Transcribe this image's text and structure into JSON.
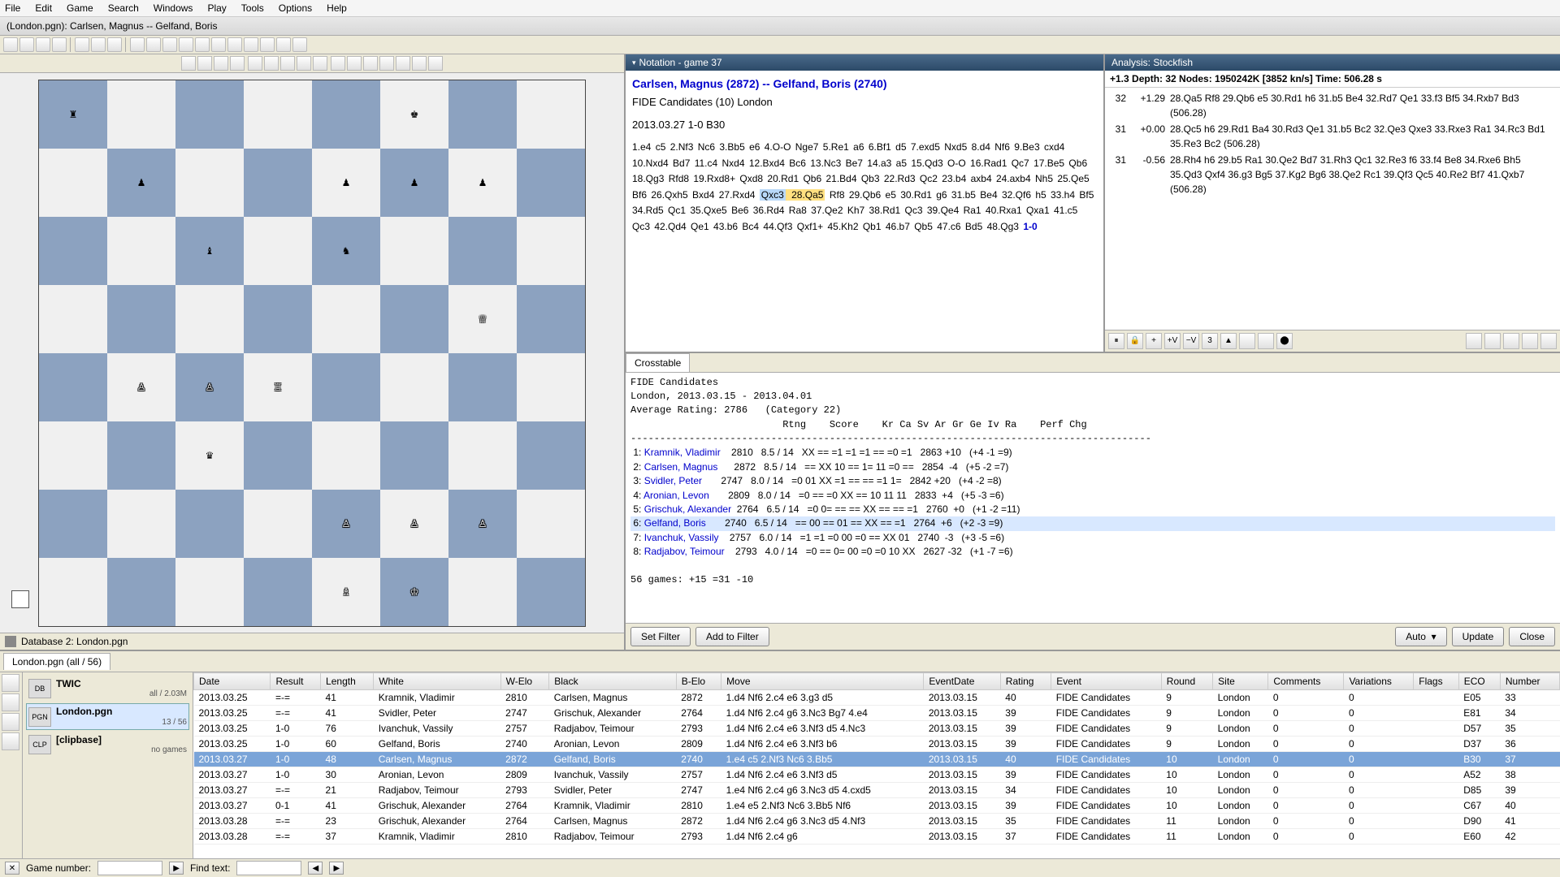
{
  "menus": [
    "File",
    "Edit",
    "Game",
    "Search",
    "Windows",
    "Play",
    "Tools",
    "Options",
    "Help"
  ],
  "window_title": "(London.pgn): Carlsen, Magnus -- Gelfand, Boris",
  "db_bar": "Database 2: London.pgn",
  "notation": {
    "panel_title": "Notation - game 37",
    "header": "Carlsen, Magnus  (2872)   --   Gelfand, Boris  (2740)",
    "sub1": "FIDE Candidates (10)  London",
    "sub2": "2013.03.27  1-0  B30",
    "moves_pre": "1.e4 c5 2.Nf3 Nc6 3.Bb5 e6 4.O-O Nge7 5.Re1 a6 6.Bf1 d5 7.exd5 Nxd5 8.d4 Nf6 9.Be3 cxd4 10.Nxd4 Bd7 11.c4 Nxd4 12.Bxd4 Bc6 13.Nc3 Be7 14.a3 a5 15.Qd3 O-O 16.Rad1 Qc7 17.Be5 Qb6 18.Qg3 Rfd8 19.Rxd8+ Qxd8 20.Rd1 Qb6 21.Bd4 Qb3 22.Rd3 Qc2 23.b4 axb4 24.axb4 Nh5 25.Qe5 Bf6 26.Qxh5 Bxd4 27.Rxd4 ",
    "hl_move": "Qxc3",
    "hl_next": " 28.Qa5",
    "moves_post": " Rf8 29.Qb6 e5 30.Rd1 g6 31.b5 Be4 32.Qf6 h5 33.h4 Bf5 34.Rd5 Qc1 35.Qxe5 Be6 36.Rd4 Ra8 37.Qe2 Kh7 38.Rd1 Qc3 39.Qe4 Ra1 40.Rxa1 Qxa1 41.c5 Qc3 42.Qd4 Qe1 43.b6 Bc4 44.Qf3 Qxf1+ 45.Kh2 Qb1 46.b7 Qb5 47.c6 Bd5 48.Qg3 ",
    "result": "1-0"
  },
  "analysis": {
    "panel_title": "Analysis: Stockfish",
    "head": "+1.3 Depth: 32 Nodes: 1950242K [3852 kn/s] Time: 506.28 s",
    "lines": [
      {
        "d": "32",
        "s": "+1.29",
        "pv": "28.Qa5 Rf8 29.Qb6 e5 30.Rd1 h6 31.b5 Be4 32.Rd7 Qe1 33.f3 Bf5 34.Rxb7 Bd3   (506.28)"
      },
      {
        "d": "31",
        "s": "+0.00",
        "pv": "28.Qc5 h6 29.Rd1 Ba4 30.Rd3 Qe1 31.b5 Bc2 32.Qe3 Qxe3 33.Rxe3 Ra1 34.Rc3 Bd1 35.Re3 Bc2   (506.28)"
      },
      {
        "d": "31",
        "s": "-0.56",
        "pv": "28.Rh4 h6 29.b5 Ra1 30.Qe2 Bd7 31.Rh3 Qc1 32.Re3 f6 33.f4 Be8 34.Rxe6 Bh5 35.Qd3 Qxf4 36.g3 Bg5 37.Kg2 Bg6 38.Qe2 Rc1 39.Qf3 Qc5 40.Re2 Bf7 41.Qxb7   (506.28)"
      }
    ],
    "tb_num": "3"
  },
  "crosstable": {
    "tab": "Crosstable",
    "text0": "FIDE Candidates",
    "text1": "London, 2013.03.15 - 2013.04.01",
    "text2": "Average Rating: 2786   (Category 22)",
    "hdr": "                          Rtng    Score    Kr Ca Sv Ar Gr Ge Iv Ra    Perf Chg",
    "sep": "-----------------------------------------------------------------------------------------",
    "rows": [
      " 1: Kramnik, Vladimir    2810   8.5 / 14   XX == =1 =1 =1 == =0 =1   2863 +10   (+4 -1 =9)",
      " 2: Carlsen, Magnus      2872   8.5 / 14   == XX 10 == 1= 11 =0 ==   2854  -4   (+5 -2 =7)",
      " 3: Svidler, Peter       2747   8.0 / 14   =0 01 XX =1 == == =1 1=   2842 +20   (+4 -2 =8)",
      " 4: Aronian, Levon       2809   8.0 / 14   =0 == =0 XX == 10 11 11   2833  +4   (+5 -3 =6)",
      " 5: Grischuk, Alexander  2764   6.5 / 14   =0 0= == == XX == == =1   2760  +0   (+1 -2 =11)",
      " 6: Gelfand, Boris       2740   6.5 / 14   == 00 == 01 == XX == =1   2764  +6   (+2 -3 =9)",
      " 7: Ivanchuk, Vassily    2757   6.0 / 14   =1 =1 =0 00 =0 == XX 01   2740  -3   (+3 -5 =6)",
      " 8: Radjabov, Teimour    2793   4.0 / 14   =0 == 0= 00 =0 =0 10 XX   2627 -32   (+1 -7 =6)"
    ],
    "hl_row_index": 5,
    "foot": "56 games: +15 =31 -10",
    "btns": {
      "set": "Set Filter",
      "add": "Add to Filter",
      "auto": "Auto",
      "update": "Update",
      "close": "Close"
    }
  },
  "bottom_tab": "London.pgn (all / 56)",
  "db_items": [
    {
      "name": "TWIC",
      "sub": "all / 2.03M",
      "sel": false,
      "ico": "DB"
    },
    {
      "name": "London.pgn",
      "sub": "13 / 56",
      "sel": true,
      "ico": "PGN"
    },
    {
      "name": "[clipbase]",
      "sub": "no games",
      "sel": false,
      "ico": "CLP"
    }
  ],
  "gl_headers": [
    "Date",
    "Result",
    "Length",
    "White",
    "W-Elo",
    "Black",
    "B-Elo",
    "Move",
    "EventDate",
    "Rating",
    "Event",
    "Round",
    "Site",
    "Comments",
    "Variations",
    "Flags",
    "ECO",
    "Number"
  ],
  "gl_rows": [
    {
      "sel": false,
      "c": [
        "2013.03.25",
        "=-=",
        "41",
        "Kramnik, Vladimir",
        "2810",
        "Carlsen, Magnus",
        "2872",
        "1.d4 Nf6 2.c4 e6 3.g3 d5",
        "2013.03.15",
        "40",
        "FIDE Candidates",
        "9",
        "London",
        "0",
        "0",
        "",
        "E05",
        "33"
      ]
    },
    {
      "sel": false,
      "c": [
        "2013.03.25",
        "=-=",
        "41",
        "Svidler, Peter",
        "2747",
        "Grischuk, Alexander",
        "2764",
        "1.d4 Nf6 2.c4 g6 3.Nc3 Bg7 4.e4",
        "2013.03.15",
        "39",
        "FIDE Candidates",
        "9",
        "London",
        "0",
        "0",
        "",
        "E81",
        "34"
      ]
    },
    {
      "sel": false,
      "c": [
        "2013.03.25",
        "1-0",
        "76",
        "Ivanchuk, Vassily",
        "2757",
        "Radjabov, Teimour",
        "2793",
        "1.d4 Nf6 2.c4 e6 3.Nf3 d5 4.Nc3",
        "2013.03.15",
        "39",
        "FIDE Candidates",
        "9",
        "London",
        "0",
        "0",
        "",
        "D57",
        "35"
      ]
    },
    {
      "sel": false,
      "c": [
        "2013.03.25",
        "1-0",
        "60",
        "Gelfand, Boris",
        "2740",
        "Aronian, Levon",
        "2809",
        "1.d4 Nf6 2.c4 e6 3.Nf3 b6",
        "2013.03.15",
        "39",
        "FIDE Candidates",
        "9",
        "London",
        "0",
        "0",
        "",
        "D37",
        "36"
      ]
    },
    {
      "sel": true,
      "c": [
        "2013.03.27",
        "1-0",
        "48",
        "Carlsen, Magnus",
        "2872",
        "Gelfand, Boris",
        "2740",
        "1.e4 c5 2.Nf3 Nc6 3.Bb5",
        "2013.03.15",
        "40",
        "FIDE Candidates",
        "10",
        "London",
        "0",
        "0",
        "",
        "B30",
        "37"
      ]
    },
    {
      "sel": false,
      "c": [
        "2013.03.27",
        "1-0",
        "30",
        "Aronian, Levon",
        "2809",
        "Ivanchuk, Vassily",
        "2757",
        "1.d4 Nf6 2.c4 e6 3.Nf3 d5",
        "2013.03.15",
        "39",
        "FIDE Candidates",
        "10",
        "London",
        "0",
        "0",
        "",
        "A52",
        "38"
      ]
    },
    {
      "sel": false,
      "c": [
        "2013.03.27",
        "=-=",
        "21",
        "Radjabov, Teimour",
        "2793",
        "Svidler, Peter",
        "2747",
        "1.e4 Nf6 2.c4 g6 3.Nc3 d5 4.cxd5",
        "2013.03.15",
        "34",
        "FIDE Candidates",
        "10",
        "London",
        "0",
        "0",
        "",
        "D85",
        "39"
      ]
    },
    {
      "sel": false,
      "c": [
        "2013.03.27",
        "0-1",
        "41",
        "Grischuk, Alexander",
        "2764",
        "Kramnik, Vladimir",
        "2810",
        "1.e4 e5 2.Nf3 Nc6 3.Bb5 Nf6",
        "2013.03.15",
        "39",
        "FIDE Candidates",
        "10",
        "London",
        "0",
        "0",
        "",
        "C67",
        "40"
      ]
    },
    {
      "sel": false,
      "c": [
        "2013.03.28",
        "=-=",
        "23",
        "Grischuk, Alexander",
        "2764",
        "Carlsen, Magnus",
        "2872",
        "1.d4 Nf6 2.c4 g6 3.Nc3 d5 4.Nf3",
        "2013.03.15",
        "35",
        "FIDE Candidates",
        "11",
        "London",
        "0",
        "0",
        "",
        "D90",
        "41"
      ]
    },
    {
      "sel": false,
      "c": [
        "2013.03.28",
        "=-=",
        "37",
        "Kramnik, Vladimir",
        "2810",
        "Radjabov, Teimour",
        "2793",
        "1.d4 Nf6 2.c4 g6",
        "2013.03.15",
        "37",
        "FIDE Candidates",
        "11",
        "London",
        "0",
        "0",
        "",
        "E60",
        "42"
      ]
    }
  ],
  "bot_bar": {
    "gn": "Game number:",
    "ft": "Find text:"
  },
  "board_fen_map": {
    "a8": "r",
    "f8": "k",
    "b7": "p",
    "e7": "p",
    "f7": "p",
    "g7": "p",
    "c6": "b",
    "e6": "n",
    "g5": "Q",
    "b4": "P",
    "c4": "P",
    "d4": "R",
    "c3": "q",
    "e2": "P",
    "f2": "P",
    "g2": "P",
    "e1": "B",
    "f1": "K"
  },
  "pieces": {
    "K": "♔",
    "Q": "♕",
    "R": "♖",
    "B": "♗",
    "N": "♘",
    "P": "♙",
    "k": "♚",
    "q": "♛",
    "r": "♜",
    "b": "♝",
    "n": "♞",
    "p": "♟"
  }
}
